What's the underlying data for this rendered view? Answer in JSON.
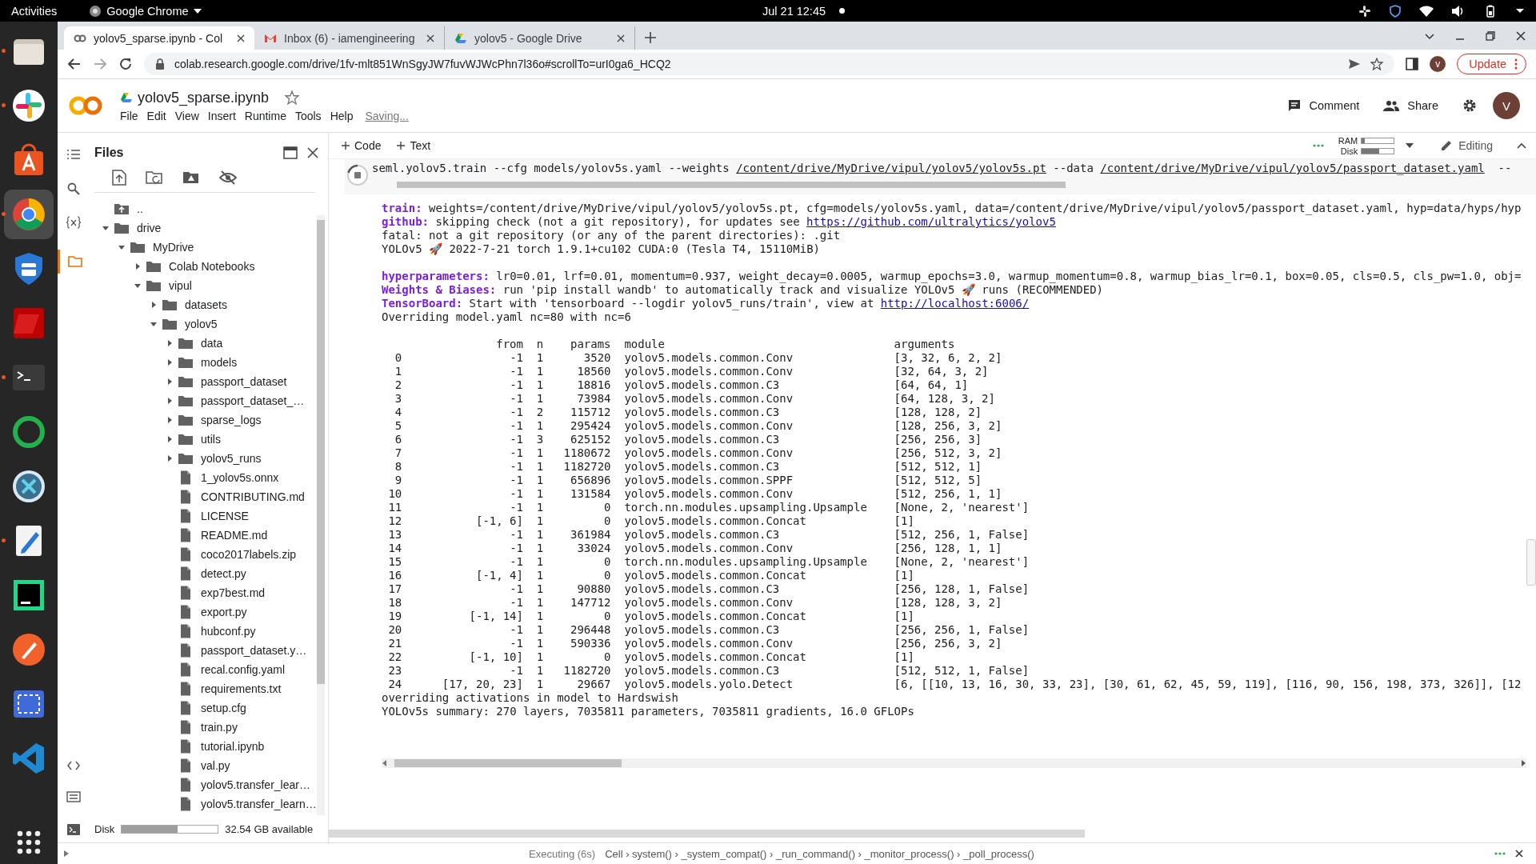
{
  "top_bar": {
    "activities": "Activities",
    "app_menu": "Google Chrome",
    "clock": "Jul 21  12:45"
  },
  "dock": [
    {
      "kind": "files",
      "running": true,
      "selected": false
    },
    {
      "kind": "slack",
      "running": true,
      "selected": false
    },
    {
      "kind": "software",
      "running": false,
      "selected": false
    },
    {
      "kind": "chrome",
      "running": true,
      "selected": true
    },
    {
      "kind": "shield",
      "running": false,
      "selected": false
    },
    {
      "kind": "filezilla",
      "running": false,
      "selected": false
    },
    {
      "kind": "terminal",
      "running": true,
      "selected": false
    },
    {
      "kind": "ring",
      "running": false,
      "selected": false
    },
    {
      "kind": "crossover",
      "running": false,
      "selected": false
    },
    {
      "kind": "editor",
      "running": true,
      "selected": false
    },
    {
      "kind": "pycharm",
      "running": false,
      "selected": false
    },
    {
      "kind": "pen",
      "running": false,
      "selected": false
    },
    {
      "kind": "screenshot",
      "running": false,
      "selected": false
    },
    {
      "kind": "vscode",
      "running": false,
      "selected": false
    }
  ],
  "browser": {
    "tabs": [
      {
        "title": "yolov5_sparse.ipynb - Col",
        "selected": true
      },
      {
        "title": "Inbox (6) - iamengineering",
        "selected": false
      },
      {
        "title": "yolov5 - Google Drive",
        "selected": false
      }
    ],
    "address": "colab.research.google.com/drive/1fv-mlt851WnSgyJW7fuvWJWcPhn7l36o#scrollTo=urI0ga6_HCQ2",
    "profile": "v",
    "update": "Update"
  },
  "colab": {
    "title": "yolov5_sparse.ipynb",
    "starred": false,
    "menu": [
      "File",
      "Edit",
      "View",
      "Insert",
      "Runtime",
      "Tools",
      "Help"
    ],
    "status": "Saving...",
    "comment": "Comment",
    "share": "Share",
    "avatar": "V",
    "add_buttons": [
      "Code",
      "Text"
    ],
    "resources": [
      {
        "label": "RAM",
        "level": 0.1
      },
      {
        "label": "Disk",
        "level": 0.55
      }
    ],
    "mode": "Editing"
  },
  "files": {
    "title": "Files",
    "tree": [
      {
        "name": "..",
        "kind": "up"
      },
      {
        "name": "drive",
        "kind": "folder",
        "expanded": true,
        "children": [
          {
            "name": "MyDrive",
            "kind": "folder",
            "expanded": true,
            "children": [
              {
                "name": "Colab Notebooks",
                "kind": "folder",
                "expanded": false
              },
              {
                "name": "vipul",
                "kind": "folder",
                "expanded": true,
                "children": [
                  {
                    "name": "datasets",
                    "kind": "folder",
                    "expanded": false
                  },
                  {
                    "name": "yolov5",
                    "kind": "folder",
                    "expanded": true,
                    "children": [
                      {
                        "name": "data",
                        "kind": "folder",
                        "expanded": false
                      },
                      {
                        "name": "models",
                        "kind": "folder",
                        "expanded": false
                      },
                      {
                        "name": "passport_dataset",
                        "kind": "folder",
                        "expanded": false
                      },
                      {
                        "name": "passport_dataset_…",
                        "kind": "folder",
                        "expanded": false
                      },
                      {
                        "name": "sparse_logs",
                        "kind": "folder",
                        "expanded": false
                      },
                      {
                        "name": "utils",
                        "kind": "folder",
                        "expanded": false
                      },
                      {
                        "name": "yolov5_runs",
                        "kind": "folder",
                        "expanded": false
                      },
                      {
                        "name": "1_yolov5s.onnx",
                        "kind": "file"
                      },
                      {
                        "name": "CONTRIBUTING.md",
                        "kind": "file"
                      },
                      {
                        "name": "LICENSE",
                        "kind": "file"
                      },
                      {
                        "name": "README.md",
                        "kind": "file"
                      },
                      {
                        "name": "coco2017labels.zip",
                        "kind": "file"
                      },
                      {
                        "name": "detect.py",
                        "kind": "file"
                      },
                      {
                        "name": "exp7best.md",
                        "kind": "file"
                      },
                      {
                        "name": "export.py",
                        "kind": "file"
                      },
                      {
                        "name": "hubconf.py",
                        "kind": "file"
                      },
                      {
                        "name": "passport_dataset.y…",
                        "kind": "file"
                      },
                      {
                        "name": "recal.config.yaml",
                        "kind": "file"
                      },
                      {
                        "name": "requirements.txt",
                        "kind": "file"
                      },
                      {
                        "name": "setup.cfg",
                        "kind": "file"
                      },
                      {
                        "name": "train.py",
                        "kind": "file"
                      },
                      {
                        "name": "tutorial.ipynb",
                        "kind": "file"
                      },
                      {
                        "name": "val.py",
                        "kind": "file"
                      },
                      {
                        "name": "yolov5.transfer_lear…",
                        "kind": "file"
                      },
                      {
                        "name": "yolov5.transfer_learn…",
                        "kind": "file"
                      }
                    ]
                  }
                ]
              }
            ]
          }
        ]
      }
    ],
    "disk": {
      "label": "Disk",
      "level": 0.58,
      "available": "32.54 GB available"
    }
  },
  "cell": {
    "running": true,
    "command": [
      {
        "text": "seml.yolov5.train --cfg models/yolov5s.yaml --weights ",
        "kind": "plain"
      },
      {
        "text": "/content/drive/MyDrive/vipul/yolov5/yolov5s.pt",
        "kind": "path"
      },
      {
        "text": " --data ",
        "kind": "plain"
      },
      {
        "text": "/content/drive/MyDrive/vipul/yolov5/passport_dataset.yaml",
        "kind": "path"
      },
      {
        "text": "  --",
        "kind": "plain"
      }
    ],
    "output_blocks": [
      [
        {
          "label": "train:",
          "text": " weights=/content/drive/MyDrive/vipul/yolov5/yolov5s.pt, cfg=models/yolov5s.yaml, data=/content/drive/MyDrive/vipul/yolov5/passport_dataset.yaml, hyp=data/hyps/hyp"
        },
        {
          "label": "github:",
          "text": " skipping check (not a git repository), for updates see ",
          "link": "https://github.com/ultralytics/yolov5"
        },
        {
          "text": "fatal: not a git repository (or any of the parent directories): .git"
        },
        {
          "text": "YOLOv5 🚀 2022-7-21 torch 1.9.1+cu102 CUDA:0 (Tesla T4, 15110MiB)"
        }
      ],
      [
        {
          "label": "hyperparameters:",
          "text": " lr0=0.01, lrf=0.01, momentum=0.937, weight_decay=0.0005, warmup_epochs=3.0, warmup_momentum=0.8, warmup_bias_lr=0.1, box=0.05, cls=0.5, cls_pw=1.0, obj="
        },
        {
          "label": "Weights & Biases:",
          "text": " run 'pip install wandb' to automatically track and visualize YOLOv5 🚀 runs (RECOMMENDED)"
        },
        {
          "label": "TensorBoard:",
          "text": " Start with 'tensorboard --logdir yolov5_runs/train', view at ",
          "link": "http://localhost:6006/"
        },
        {
          "text": "Overriding model.yaml nc=80 with nc=6"
        }
      ]
    ],
    "table": {
      "columns": [
        "from",
        "n",
        "params",
        "module",
        "arguments"
      ],
      "rows": [
        {
          "index": "0",
          "cells": [
            "-1",
            "1",
            "3520",
            "yolov5.models.common.Conv",
            "[3, 32, 6, 2, 2]"
          ]
        },
        {
          "index": "1",
          "cells": [
            "-1",
            "1",
            "18560",
            "yolov5.models.common.Conv",
            "[32, 64, 3, 2]"
          ]
        },
        {
          "index": "2",
          "cells": [
            "-1",
            "1",
            "18816",
            "yolov5.models.common.C3",
            "[64, 64, 1]"
          ]
        },
        {
          "index": "3",
          "cells": [
            "-1",
            "1",
            "73984",
            "yolov5.models.common.Conv",
            "[64, 128, 3, 2]"
          ]
        },
        {
          "index": "4",
          "cells": [
            "-1",
            "2",
            "115712",
            "yolov5.models.common.C3",
            "[128, 128, 2]"
          ]
        },
        {
          "index": "5",
          "cells": [
            "-1",
            "1",
            "295424",
            "yolov5.models.common.Conv",
            "[128, 256, 3, 2]"
          ]
        },
        {
          "index": "6",
          "cells": [
            "-1",
            "3",
            "625152",
            "yolov5.models.common.C3",
            "[256, 256, 3]"
          ]
        },
        {
          "index": "7",
          "cells": [
            "-1",
            "1",
            "1180672",
            "yolov5.models.common.Conv",
            "[256, 512, 3, 2]"
          ]
        },
        {
          "index": "8",
          "cells": [
            "-1",
            "1",
            "1182720",
            "yolov5.models.common.C3",
            "[512, 512, 1]"
          ]
        },
        {
          "index": "9",
          "cells": [
            "-1",
            "1",
            "656896",
            "yolov5.models.common.SPPF",
            "[512, 512, 5]"
          ]
        },
        {
          "index": "10",
          "cells": [
            "-1",
            "1",
            "131584",
            "yolov5.models.common.Conv",
            "[512, 256, 1, 1]"
          ]
        },
        {
          "index": "11",
          "cells": [
            "-1",
            "1",
            "0",
            "torch.nn.modules.upsampling.Upsample",
            "[None, 2, 'nearest']"
          ]
        },
        {
          "index": "12",
          "cells": [
            "[-1, 6]",
            "1",
            "0",
            "yolov5.models.common.Concat",
            "[1]"
          ]
        },
        {
          "index": "13",
          "cells": [
            "-1",
            "1",
            "361984",
            "yolov5.models.common.C3",
            "[512, 256, 1, False]"
          ]
        },
        {
          "index": "14",
          "cells": [
            "-1",
            "1",
            "33024",
            "yolov5.models.common.Conv",
            "[256, 128, 1, 1]"
          ]
        },
        {
          "index": "15",
          "cells": [
            "-1",
            "1",
            "0",
            "torch.nn.modules.upsampling.Upsample",
            "[None, 2, 'nearest']"
          ]
        },
        {
          "index": "16",
          "cells": [
            "[-1, 4]",
            "1",
            "0",
            "yolov5.models.common.Concat",
            "[1]"
          ]
        },
        {
          "index": "17",
          "cells": [
            "-1",
            "1",
            "90880",
            "yolov5.models.common.C3",
            "[256, 128, 1, False]"
          ]
        },
        {
          "index": "18",
          "cells": [
            "-1",
            "1",
            "147712",
            "yolov5.models.common.Conv",
            "[128, 128, 3, 2]"
          ]
        },
        {
          "index": "19",
          "cells": [
            "[-1, 14]",
            "1",
            "0",
            "yolov5.models.common.Concat",
            "[1]"
          ]
        },
        {
          "index": "20",
          "cells": [
            "-1",
            "1",
            "296448",
            "yolov5.models.common.C3",
            "[256, 256, 1, False]"
          ]
        },
        {
          "index": "21",
          "cells": [
            "-1",
            "1",
            "590336",
            "yolov5.models.common.Conv",
            "[256, 256, 3, 2]"
          ]
        },
        {
          "index": "22",
          "cells": [
            "[-1, 10]",
            "1",
            "0",
            "yolov5.models.common.Concat",
            "[1]"
          ]
        },
        {
          "index": "23",
          "cells": [
            "-1",
            "1",
            "1182720",
            "yolov5.models.common.C3",
            "[512, 512, 1, False]"
          ]
        },
        {
          "index": "24",
          "cells": [
            "[17, 20, 23]",
            "1",
            "29667",
            "yolov5.models.yolo.Detect",
            "[6, [[10, 13, 16, 30, 33, 23], [30, 61, 62, 45, 59, 119], [116, 90, 156, 198, 373, 326]], [12"
          ]
        }
      ]
    },
    "footer": [
      "overriding activations in model to Hardswish",
      "YOLOv5s summary: 270 layers, 7035811 parameters, 7035811 gradients, 16.0 GFLOPs"
    ]
  },
  "status_bar": {
    "executing": "Executing (6s)",
    "trace": "Cell › system() › _system_compat() › _run_command() › _monitor_process() › _poll_process()"
  }
}
